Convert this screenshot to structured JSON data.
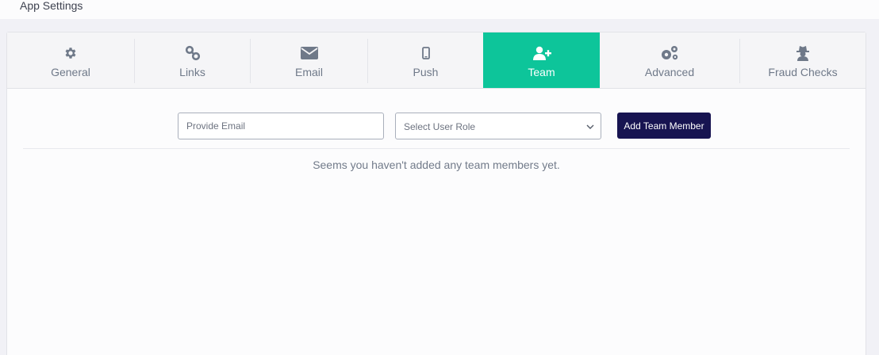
{
  "app": {
    "title": "App Settings"
  },
  "tabs": [
    {
      "key": "general",
      "label": "General",
      "icon": "gear-icon"
    },
    {
      "key": "links",
      "label": "Links",
      "icon": "link-icon"
    },
    {
      "key": "email",
      "label": "Email",
      "icon": "envelope-icon"
    },
    {
      "key": "push",
      "label": "Push",
      "icon": "mobile-phone-icon"
    },
    {
      "key": "team",
      "label": "Team",
      "icon": "add-user-icon",
      "active": true
    },
    {
      "key": "advanced",
      "label": "Advanced",
      "icon": "gears-icon"
    },
    {
      "key": "fraud",
      "label": "Fraud Checks",
      "icon": "spy-icon"
    }
  ],
  "team": {
    "email_placeholder": "Provide Email",
    "role_select_value": "Select User Role",
    "add_button_label": "Add Team Member",
    "empty_message": "Seems you haven't added any team members yet."
  },
  "colors": {
    "accent": "#0dc59a",
    "button": "#171451",
    "tab_icon": "#6f7989"
  }
}
